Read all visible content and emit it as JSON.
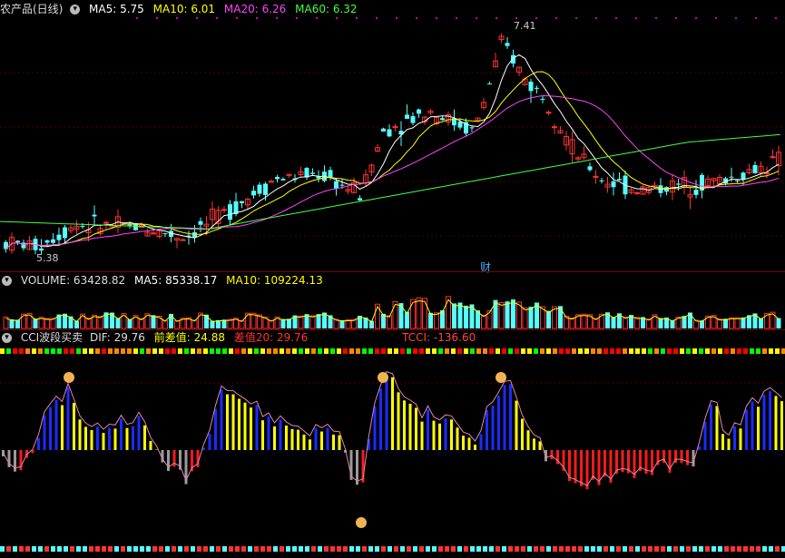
{
  "main": {
    "title": "农产品(日线)",
    "ma": [
      {
        "label": "MA5: 5.75",
        "color": "#ffffff"
      },
      {
        "label": "MA10: 6.01",
        "color": "#ffff00"
      },
      {
        "label": "MA20: 6.26",
        "color": "#ff44ff"
      },
      {
        "label": "MA60: 6.32",
        "color": "#44ff44"
      }
    ],
    "high_label": "7.41",
    "low_label": "5.38",
    "event_marker": "财"
  },
  "volume": {
    "title": "VOLUME: 63428.82",
    "ma5": "MA5: 85338.17",
    "ma10": "MA10: 109224.13"
  },
  "indicator": {
    "title": "CCI波段买卖",
    "dif": "DIF: 29.76",
    "prev": "前差值: 24.88",
    "diff20": "差值20: 29.76",
    "tcci": "TCCI: -136.60"
  },
  "colors": {
    "up": "#ff3232",
    "down": "#54ffff",
    "ma5": "#ffffff",
    "ma10": "#ffff00",
    "ma20": "#ff44ff",
    "ma60": "#44ff44",
    "bar_blue": "#1a2cff",
    "bar_yellow": "#ffff00",
    "bar_red": "#ff1a1a",
    "bar_gray": "#9a9a9a"
  },
  "icons": [
    "settings-gear-icon",
    "hand-pointer-icon"
  ]
}
